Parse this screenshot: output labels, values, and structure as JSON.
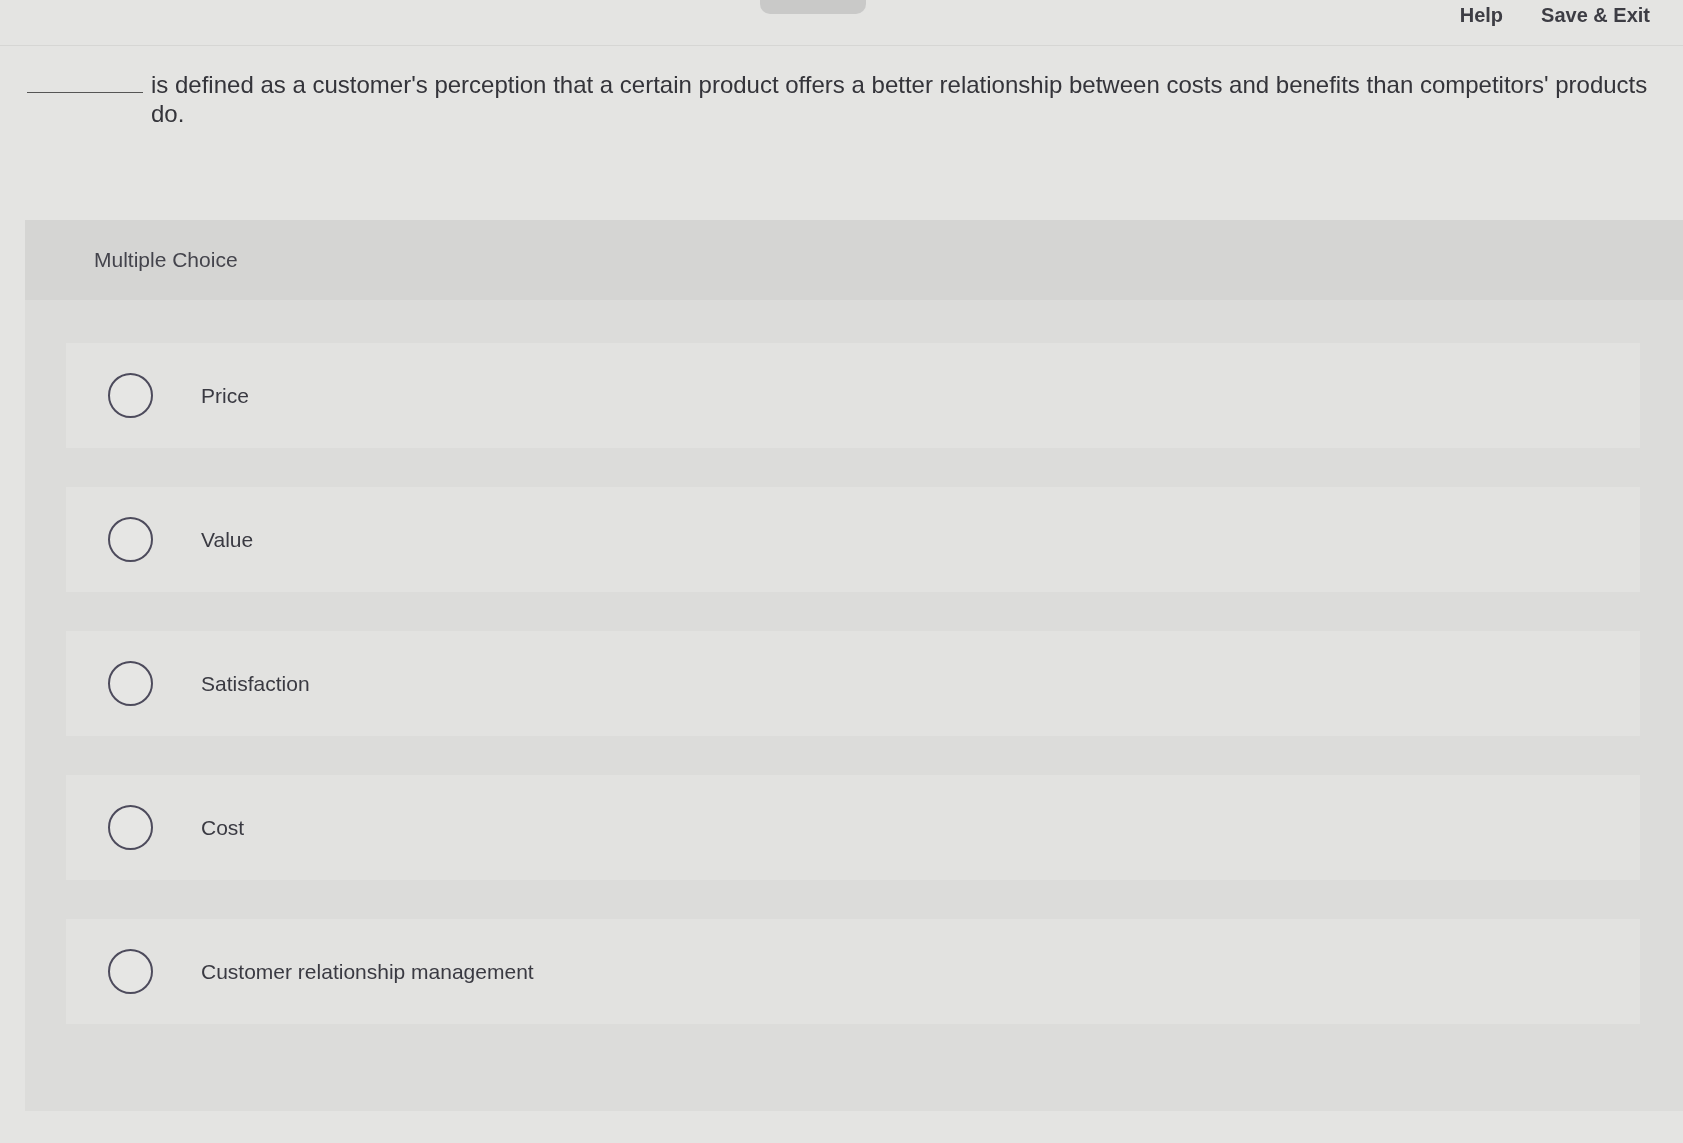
{
  "header": {
    "links": [
      "Help",
      "Save & Exit"
    ]
  },
  "question": {
    "text": "is defined as a customer's perception that a certain product offers a better relationship between costs and benefits than competitors' products do."
  },
  "multiple_choice": {
    "label": "Multiple Choice",
    "options": [
      {
        "label": "Price",
        "selected": false
      },
      {
        "label": "Value",
        "selected": false
      },
      {
        "label": "Satisfaction",
        "selected": false
      },
      {
        "label": "Cost",
        "selected": false
      },
      {
        "label": "Customer relationship management",
        "selected": false
      }
    ]
  }
}
